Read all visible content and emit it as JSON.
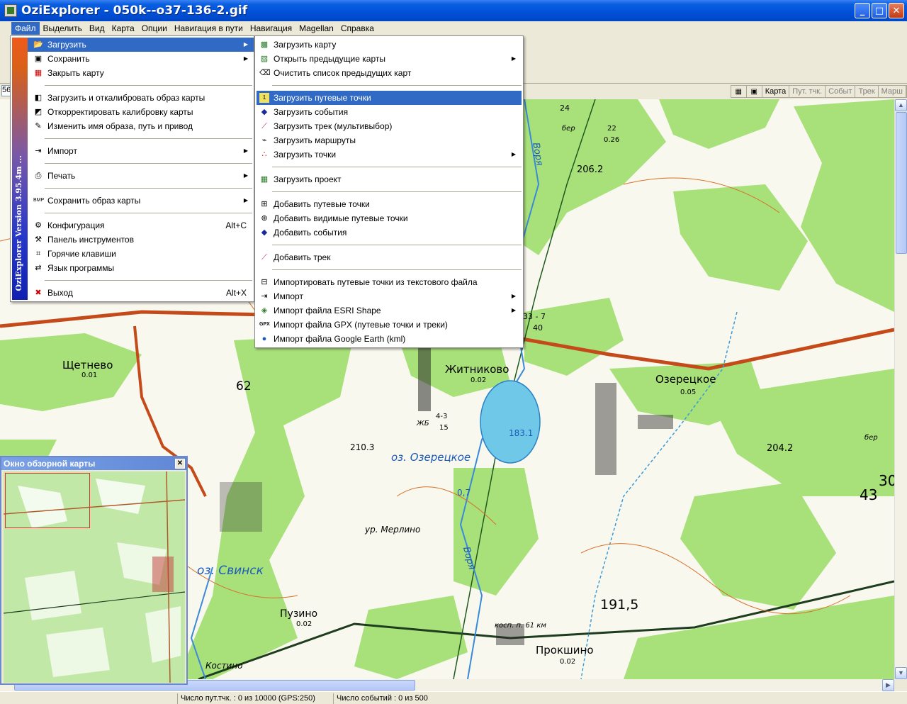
{
  "window": {
    "title": "OziExplorer - 050k--o37-136-2.gif",
    "min": "_",
    "max": "□",
    "close": "✕"
  },
  "menubar": [
    "Файл",
    "Выделить",
    "Вид",
    "Карта",
    "Опции",
    "Навигация в пути",
    "Навигация",
    "Magellan",
    "Справка"
  ],
  "toolbar2": {
    "combo_value": "56"
  },
  "modebar": {
    "carta": "Карта",
    "waypoints": "Пут. тчк.",
    "events": "Событ",
    "track": "Трек",
    "route": "Марш"
  },
  "file_menu": {
    "sidebar_text": "OziExplorer  Version 3.95.4m ...",
    "items": [
      {
        "label": "Загрузить",
        "icon": "open-icon",
        "arrow": true
      },
      {
        "label": "Сохранить",
        "icon": "save-icon",
        "arrow": true
      },
      {
        "label": "Закрыть карту",
        "icon": "close-map-icon"
      },
      {
        "label": "Загрузить и откалибровать образ карты",
        "icon": "calibrate-icon"
      },
      {
        "label": "Откорректировать калибровку карты",
        "icon": "adjust-icon"
      },
      {
        "label": "Изменить имя образа, путь и привод",
        "icon": "rename-icon"
      },
      {
        "label": "Импорт",
        "icon": "import-icon",
        "arrow": true
      },
      {
        "label": "Печать",
        "icon": "print-icon",
        "arrow": true
      },
      {
        "label": "Сохранить образ карты",
        "icon": "bmp-icon",
        "arrow": true
      },
      {
        "label": "Конфигурация",
        "icon": "config-icon",
        "shortcut": "Alt+C"
      },
      {
        "label": "Панель инструментов",
        "icon": "toolbar-icon"
      },
      {
        "label": "Горячие клавиши",
        "icon": "hotkeys-icon"
      },
      {
        "label": "Язык программы",
        "icon": "language-icon"
      },
      {
        "label": "Выход",
        "icon": "exit-icon",
        "shortcut": "Alt+X"
      }
    ]
  },
  "load_submenu": {
    "items": [
      {
        "label": "Загрузить карту",
        "icon": "map-icon"
      },
      {
        "label": "Открыть предыдущие карты",
        "icon": "recent-maps-icon",
        "arrow": true
      },
      {
        "label": "Очистить список предыдущих карт",
        "icon": "eraser-icon"
      },
      {
        "label": "Загрузить путевые точки",
        "icon": "waypoint-icon"
      },
      {
        "label": "Загрузить события",
        "icon": "event-icon"
      },
      {
        "label": "Загрузить трек (мультивыбор)",
        "icon": "track-icon"
      },
      {
        "label": "Загрузить маршруты",
        "icon": "route-icon"
      },
      {
        "label": "Загрузить точки",
        "icon": "points-icon",
        "arrow": true
      },
      {
        "label": "Загрузить проект",
        "icon": "project-icon"
      },
      {
        "label": "Добавить путевые точки",
        "icon": "add-waypoint-icon"
      },
      {
        "label": "Добавить видимые путевые точки",
        "icon": "add-visible-waypoint-icon"
      },
      {
        "label": "Добавить события",
        "icon": "add-event-icon"
      },
      {
        "label": "Добавить трек",
        "icon": "add-track-icon"
      },
      {
        "label": "Импортировать путевые точки из текстового файла",
        "icon": "import-text-icon"
      },
      {
        "label": "Импорт",
        "icon": "import-icon",
        "arrow": true
      },
      {
        "label": "Импорт файла ESRI Shape",
        "icon": "esri-icon",
        "arrow": true
      },
      {
        "label": "Импорт файла GPX (путевые точки и треки)",
        "icon": "gpx-icon"
      },
      {
        "label": "Импорт файла Google Earth (kml)",
        "icon": "google-earth-icon"
      }
    ]
  },
  "overview": {
    "title": "Окно обзорной карты",
    "close": "✕"
  },
  "map_labels": {
    "schetnevo": "Щетнево",
    "schetnevo_num": "0.01",
    "zhitnikovo": "Житниково",
    "zhitnikovo_num": "0.02",
    "ozeretskoe": "Озерецкое",
    "ozeretskoe_num": "0.05",
    "lake_ozeretskoe": "оз. Озерецкое",
    "lake_svinsk": "оз. Свинск",
    "puzino": "Пузино",
    "puzino_num": "0.02",
    "prokshino": "Прокшино",
    "prokshino_num": "0.02",
    "kostino": "Костино",
    "merlino": "ур. Мерлино",
    "vorya": "Воря",
    "vorya2": "Воря",
    "h206": "206.2",
    "h191": "191,5",
    "h204": "204.2",
    "h2103": "210.3",
    "h1831": "183.1",
    "n62": "62",
    "n24": "24",
    "n43": "43",
    "n30": "30",
    "n07": "0,7",
    "zhb": "ЖБ",
    "zhb43": "4-3",
    "zhb15": "15",
    "cnt33": "33 - 7",
    "cnt40": "40",
    "ber1": "бер",
    "ber2": "бер",
    "frac22": "22",
    "frac026": "0.26",
    "kosp": "косп. п. 61 км"
  },
  "status": {
    "waypoints": "Число пут.тчк. : 0 из 10000  (GPS:250)",
    "events": "Число событий : 0 из 500"
  }
}
